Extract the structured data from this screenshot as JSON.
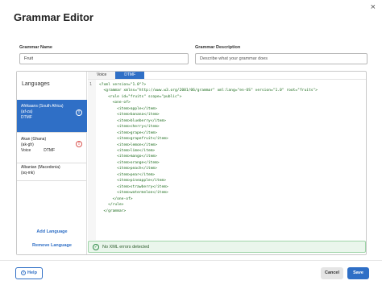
{
  "title": "Grammar Editor",
  "close_glyph": "×",
  "fields": {
    "name_label": "Grammar Name",
    "name_value": "Fruit",
    "description_label": "Grammar Description",
    "description_placeholder": "Describe what your grammar does"
  },
  "languages": {
    "heading": "Languages",
    "items": [
      {
        "name": "Afrikaans (South Africa)",
        "code": "(af-za)",
        "modes": [
          "DTMF"
        ],
        "badge": "!"
      },
      {
        "name": "Akan (Ghana)",
        "code": "(ak-gh)",
        "modes": [
          "Voice",
          "DTMF"
        ],
        "badge": "!"
      },
      {
        "name": "Albanian (Macedonia)",
        "code": "(sq-mk)",
        "modes": [],
        "badge": ""
      }
    ],
    "add_label": "Add Language",
    "remove_label": "Remove Language"
  },
  "tabs": [
    "Voice",
    "DTMF"
  ],
  "editor": {
    "line_number": "1",
    "lines": [
      "<?xml version=\"1.0\"?>",
      "  <grammar xmlns=\"http://www.w3.org/2001/06/grammar\" xml:lang=\"en-US\" version=\"1.0\" root=\"fruits\">",
      "    <rule id=\"fruits\" scope=\"public\">",
      "      <one-of>",
      "        <item>apple</item>",
      "        <item>banana</item>",
      "        <item>blueberry</item>",
      "        <item>cherry</item>",
      "        <item>grape</item>",
      "        <item>grapefruit</item>",
      "        <item>lemon</item>",
      "        <item>lime</item>",
      "        <item>mango</item>",
      "        <item>orange</item>",
      "        <item>peach</item>",
      "        <item>pear</item>",
      "        <item>pineapple</item>",
      "        <item>strawberry</item>",
      "        <item>watermelon</item>",
      "      </one-of>",
      "    </rule>",
      "  </grammar>"
    ]
  },
  "status": {
    "check_glyph": "✓",
    "text": "No XML errors detected"
  },
  "buttons": {
    "help_glyph": "?",
    "help": "Help",
    "cancel": "Cancel",
    "save": "Save"
  },
  "colors": {
    "accent": "#2f6fc6",
    "success": "#2e8b47",
    "error": "#d9534f"
  }
}
